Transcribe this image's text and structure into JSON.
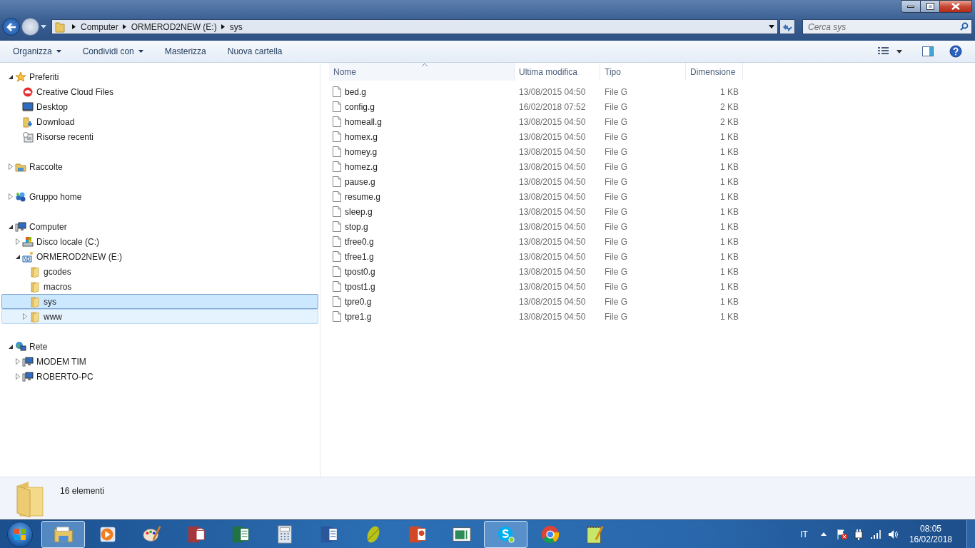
{
  "address_bar": {
    "segments": [
      "Computer",
      "ORMEROD2NEW (E:)",
      "sys"
    ]
  },
  "search": {
    "placeholder": "Cerca sys"
  },
  "toolbar": {
    "buttons": [
      {
        "label": "Organizza",
        "has_menu": true
      },
      {
        "label": "Condividi con",
        "has_menu": true
      },
      {
        "label": "Masterizza",
        "has_menu": false
      },
      {
        "label": "Nuova cartella",
        "has_menu": false
      }
    ]
  },
  "navigation": {
    "items": [
      {
        "label": "Preferiti",
        "kind": "star",
        "expanded": true,
        "selected": false,
        "hovered": false,
        "children": [
          {
            "label": "Creative Cloud Files",
            "kind": "cloud",
            "selected": false,
            "hovered": false
          },
          {
            "label": "Desktop",
            "kind": "desktop",
            "selected": false,
            "hovered": false
          },
          {
            "label": "Download",
            "kind": "download",
            "selected": false,
            "hovered": false
          },
          {
            "label": "Risorse recenti",
            "kind": "recent",
            "selected": false,
            "hovered": false
          }
        ]
      },
      {
        "label": "Raccolte",
        "kind": "libraries",
        "expanded": false,
        "selected": false,
        "hovered": false
      },
      {
        "label": "Gruppo home",
        "kind": "homegroup",
        "expanded": false,
        "selected": false,
        "hovered": false
      },
      {
        "label": "Computer",
        "kind": "computer",
        "expanded": true,
        "selected": false,
        "hovered": false,
        "children": [
          {
            "label": "Disco locale (C:)",
            "kind": "drive",
            "expanded": false,
            "selected": false,
            "hovered": false
          },
          {
            "label": "ORMEROD2NEW (E:)",
            "kind": "sdcard",
            "expanded": true,
            "selected": false,
            "hovered": false,
            "children": [
              {
                "label": "gcodes",
                "kind": "folder",
                "selected": false,
                "hovered": false
              },
              {
                "label": "macros",
                "kind": "folder",
                "selected": false,
                "hovered": false
              },
              {
                "label": "sys",
                "kind": "folder",
                "selected": true,
                "hovered": false
              },
              {
                "label": "www",
                "kind": "folder",
                "expanded": false,
                "selected": false,
                "hovered": true
              }
            ]
          }
        ]
      },
      {
        "label": "Rete",
        "kind": "network",
        "expanded": true,
        "selected": false,
        "hovered": false,
        "children": [
          {
            "label": "MODEM TIM",
            "kind": "pc",
            "expanded": false,
            "selected": false,
            "hovered": false
          },
          {
            "label": "ROBERTO-PC",
            "kind": "pc",
            "expanded": false,
            "selected": false,
            "hovered": false
          }
        ]
      }
    ]
  },
  "file_list": {
    "columns": [
      {
        "label": "Nome",
        "sorted": true
      },
      {
        "label": "Ultima modifica",
        "sorted": false
      },
      {
        "label": "Tipo",
        "sorted": false
      },
      {
        "label": "Dimensione",
        "sorted": false
      }
    ],
    "rows": [
      [
        "bed.g",
        "13/08/2015 04:50",
        "File G",
        "1 KB"
      ],
      [
        "config.g",
        "16/02/2018 07:52",
        "File G",
        "2 KB"
      ],
      [
        "homeall.g",
        "13/08/2015 04:50",
        "File G",
        "2 KB"
      ],
      [
        "homex.g",
        "13/08/2015 04:50",
        "File G",
        "1 KB"
      ],
      [
        "homey.g",
        "13/08/2015 04:50",
        "File G",
        "1 KB"
      ],
      [
        "homez.g",
        "13/08/2015 04:50",
        "File G",
        "1 KB"
      ],
      [
        "pause.g",
        "13/08/2015 04:50",
        "File G",
        "1 KB"
      ],
      [
        "resume.g",
        "13/08/2015 04:50",
        "File G",
        "1 KB"
      ],
      [
        "sleep.g",
        "13/08/2015 04:50",
        "File G",
        "1 KB"
      ],
      [
        "stop.g",
        "13/08/2015 04:50",
        "File G",
        "1 KB"
      ],
      [
        "tfree0.g",
        "13/08/2015 04:50",
        "File G",
        "1 KB"
      ],
      [
        "tfree1.g",
        "13/08/2015 04:50",
        "File G",
        "1 KB"
      ],
      [
        "tpost0.g",
        "13/08/2015 04:50",
        "File G",
        "1 KB"
      ],
      [
        "tpost1.g",
        "13/08/2015 04:50",
        "File G",
        "1 KB"
      ],
      [
        "tpre0.g",
        "13/08/2015 04:50",
        "File G",
        "1 KB"
      ],
      [
        "tpre1.g",
        "13/08/2015 04:50",
        "File G",
        "1 KB"
      ]
    ]
  },
  "details_pane": {
    "item_count": "16 elementi"
  },
  "taskbar": {
    "apps": [
      {
        "kind": "explorer",
        "active": true
      },
      {
        "kind": "media",
        "active": false
      },
      {
        "kind": "paint",
        "active": false
      },
      {
        "kind": "access",
        "active": false
      },
      {
        "kind": "excel",
        "active": false
      },
      {
        "kind": "calculator",
        "active": false
      },
      {
        "kind": "word",
        "active": false
      },
      {
        "kind": "leaf",
        "active": false
      },
      {
        "kind": "powerpoint",
        "active": false
      },
      {
        "kind": "window",
        "active": false
      },
      {
        "kind": "skype",
        "active": true
      },
      {
        "kind": "chrome",
        "active": false
      },
      {
        "kind": "notepad",
        "active": false
      }
    ],
    "language": "IT",
    "time": "08:05",
    "date": "16/02/2018"
  }
}
